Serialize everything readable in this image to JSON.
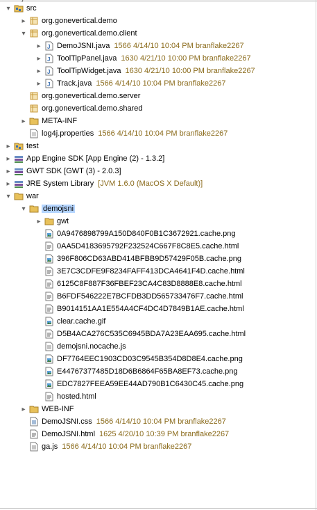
{
  "view_title": "demojsni",
  "tree": [
    {
      "label": "src",
      "depth": 0,
      "toggle": "open",
      "icon": "source-folder-icon",
      "interactable": true
    },
    {
      "label": "org.gonevertical.demo",
      "depth": 1,
      "toggle": "closed",
      "icon": "package-icon"
    },
    {
      "label": "org.gonevertical.demo.client",
      "depth": 1,
      "toggle": "open",
      "icon": "package-icon"
    },
    {
      "label": "DemoJSNI.java",
      "meta": "1566  4/14/10 10:04 PM  branflake2267",
      "depth": 2,
      "toggle": "closed",
      "icon": "java-file-icon"
    },
    {
      "label": "ToolTipPanel.java",
      "meta": "1630  4/21/10 10:00 PM  branflake2267",
      "depth": 2,
      "toggle": "closed",
      "icon": "java-file-icon"
    },
    {
      "label": "ToolTipWidget.java",
      "meta": "1630  4/21/10 10:00 PM  branflake2267",
      "depth": 2,
      "toggle": "closed",
      "icon": "java-file-icon"
    },
    {
      "label": "Track.java",
      "meta": "1566  4/14/10 10:04 PM  branflake2267",
      "depth": 2,
      "toggle": "closed",
      "icon": "java-file-icon"
    },
    {
      "label": "org.gonevertical.demo.server",
      "depth": 1,
      "toggle": "none",
      "icon": "package-icon"
    },
    {
      "label": "org.gonevertical.demo.shared",
      "depth": 1,
      "toggle": "none",
      "icon": "package-icon"
    },
    {
      "label": "META-INF",
      "depth": 1,
      "toggle": "closed",
      "icon": "folder-icon"
    },
    {
      "label": "log4j.properties",
      "meta": "1566  4/14/10 10:04 PM  branflake2267",
      "depth": 1,
      "toggle": "none",
      "icon": "properties-file-icon"
    },
    {
      "label": "test",
      "depth": 0,
      "toggle": "closed",
      "icon": "source-folder-icon"
    },
    {
      "label": "App Engine SDK [App Engine (2) - 1.3.2]",
      "depth": 0,
      "toggle": "closed",
      "icon": "library-icon"
    },
    {
      "label": "GWT SDK [GWT (3) - 2.0.3]",
      "depth": 0,
      "toggle": "closed",
      "icon": "library-icon"
    },
    {
      "label": "JRE System Library",
      "meta": "[JVM 1.6.0 (MacOS X Default)]",
      "depth": 0,
      "toggle": "closed",
      "icon": "library-icon"
    },
    {
      "label": "war",
      "depth": 0,
      "toggle": "open",
      "icon": "folder-icon"
    },
    {
      "label": "demojsni",
      "depth": 1,
      "toggle": "open",
      "icon": "folder-icon",
      "selected": true
    },
    {
      "label": "gwt",
      "depth": 2,
      "toggle": "closed",
      "icon": "folder-icon"
    },
    {
      "label": "0A9476898799A150D840F0B1C3672921.cache.png",
      "depth": 2,
      "toggle": "none",
      "icon": "image-file-icon"
    },
    {
      "label": "0AA5D4183695792F232524C667F8C8E5.cache.html",
      "depth": 2,
      "toggle": "none",
      "icon": "html-file-icon"
    },
    {
      "label": "396F806CD63ABD414BFBB9D57429F05B.cache.png",
      "depth": 2,
      "toggle": "none",
      "icon": "image-file-icon"
    },
    {
      "label": "3E7C3CDFE9F8234FAFF413DCA4641F4D.cache.html",
      "depth": 2,
      "toggle": "none",
      "icon": "html-file-icon"
    },
    {
      "label": "6125C8F887F36FBEF23CA4C83D8888E8.cache.html",
      "depth": 2,
      "toggle": "none",
      "icon": "html-file-icon"
    },
    {
      "label": "B6FDF546222E7BCFDB3DD565733476F7.cache.html",
      "depth": 2,
      "toggle": "none",
      "icon": "html-file-icon"
    },
    {
      "label": "B9014151AA1E554A4CF4DC4D7849B1AE.cache.html",
      "depth": 2,
      "toggle": "none",
      "icon": "html-file-icon"
    },
    {
      "label": "clear.cache.gif",
      "depth": 2,
      "toggle": "none",
      "icon": "image-file-icon"
    },
    {
      "label": "D5B4ACA276C535C6945BDA7A23EAA695.cache.html",
      "depth": 2,
      "toggle": "none",
      "icon": "html-file-icon"
    },
    {
      "label": "demojsni.nocache.js",
      "depth": 2,
      "toggle": "none",
      "icon": "js-file-icon"
    },
    {
      "label": "DF7764EEC1903CD03C9545B354D8D8E4.cache.png",
      "depth": 2,
      "toggle": "none",
      "icon": "image-file-icon"
    },
    {
      "label": "E44767377485D18D6B6864F65BA8EF73.cache.png",
      "depth": 2,
      "toggle": "none",
      "icon": "image-file-icon"
    },
    {
      "label": "EDC7827FEEA59EE44AD790B1C6430C45.cache.png",
      "depth": 2,
      "toggle": "none",
      "icon": "image-file-icon"
    },
    {
      "label": "hosted.html",
      "depth": 2,
      "toggle": "none",
      "icon": "html-file-icon"
    },
    {
      "label": "WEB-INF",
      "depth": 1,
      "toggle": "closed",
      "icon": "folder-icon"
    },
    {
      "label": "DemoJSNI.css",
      "meta": "1566  4/14/10 10:04 PM  branflake2267",
      "depth": 1,
      "toggle": "none",
      "icon": "css-file-icon"
    },
    {
      "label": "DemoJSNI.html",
      "meta": "1625  4/20/10 10:39 PM  branflake2267",
      "depth": 1,
      "toggle": "none",
      "icon": "html-file-icon"
    },
    {
      "label": "ga.js",
      "meta": "1566  4/14/10 10:04 PM  branflake2267",
      "depth": 1,
      "toggle": "none",
      "icon": "js-file-icon"
    }
  ],
  "colors": {
    "selection": "#b5d5ff",
    "meta_text": "#8a6a1a",
    "folder": "#e8c15a",
    "package": "#c89a3a",
    "java": "#3b6fb0",
    "library": "#7a4e9a"
  }
}
